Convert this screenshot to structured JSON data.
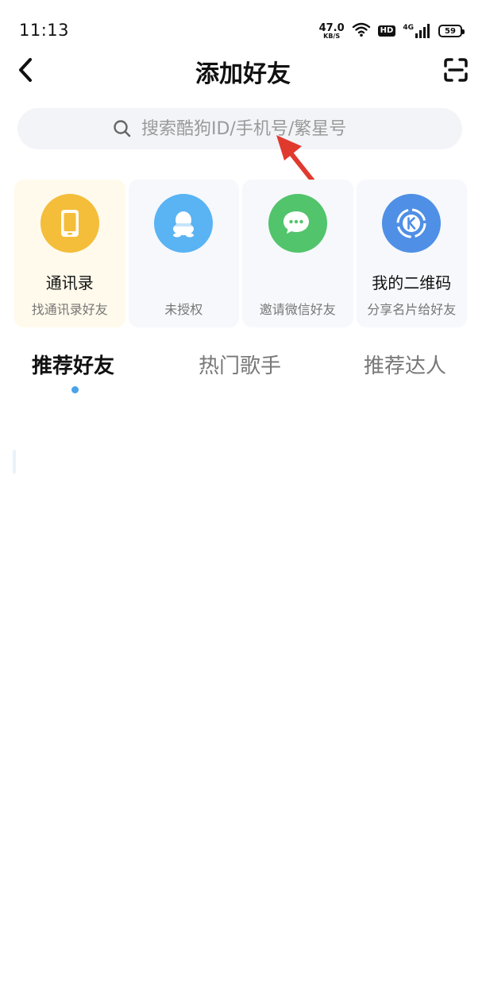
{
  "status_bar": {
    "time": "11:13",
    "net_speed_value": "47.0",
    "net_speed_unit": "KB/S",
    "hd": "HD",
    "network": "4G",
    "battery": "59"
  },
  "header": {
    "title": "添加好友",
    "back_icon": "chevron-left-icon",
    "scan_icon": "scan-icon"
  },
  "search": {
    "placeholder": "搜索酷狗ID/手机号/繁星号"
  },
  "actions": [
    {
      "title": "通讯录",
      "subtitle": "找通讯录好友",
      "icon": "phone-book-icon",
      "color": "#f4bd3a"
    },
    {
      "title": "",
      "subtitle": "未授权",
      "icon": "qq-penguin-icon",
      "color": "#5ab3f2"
    },
    {
      "title": "",
      "subtitle": "邀请微信好友",
      "icon": "wechat-icon",
      "color": "#52c46c"
    },
    {
      "title": "我的二维码",
      "subtitle": "分享名片给好友",
      "icon": "kugou-k-icon",
      "color": "#4f8fe6"
    }
  ],
  "tabs": [
    {
      "label": "推荐好友",
      "active": true
    },
    {
      "label": "热门歌手",
      "active": false
    },
    {
      "label": "推荐达人",
      "active": false
    }
  ],
  "colors": {
    "accent": "#4aa3e8",
    "annotation": "#e03a2f"
  }
}
